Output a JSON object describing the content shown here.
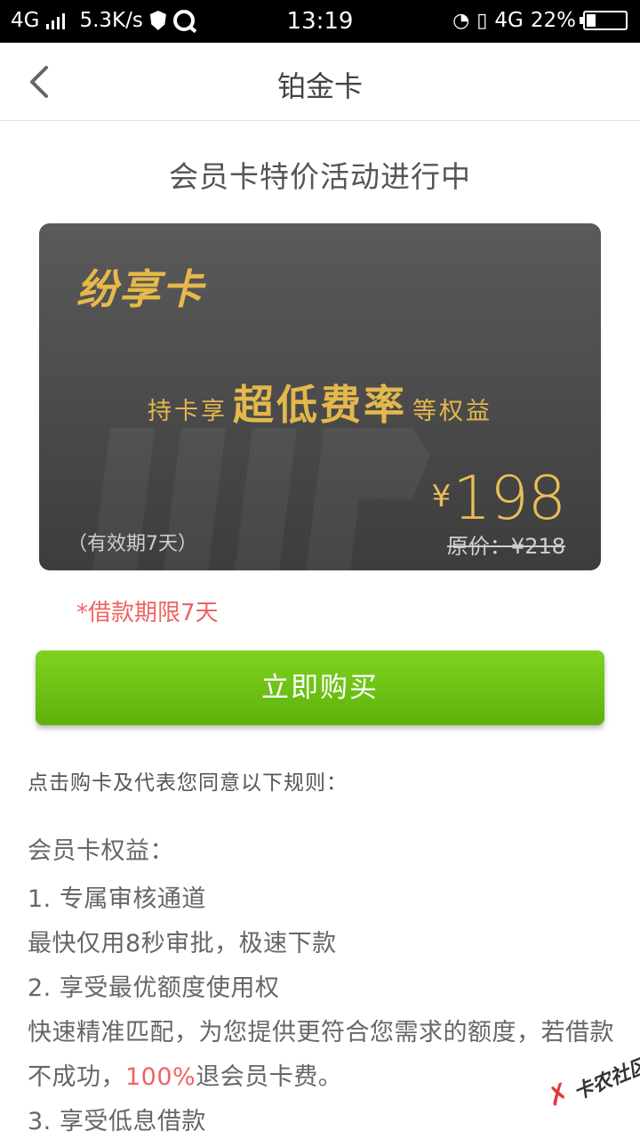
{
  "status_bar": {
    "network": "4G",
    "speed": "5.3K/s",
    "time": "13:19",
    "network2": "4G",
    "battery": "22%",
    "battery_level": 0.22
  },
  "nav": {
    "title": "铂金卡"
  },
  "promo": {
    "text": "会员卡特价活动进行中"
  },
  "card": {
    "brand": "纷享卡",
    "benefit_prefix": "持卡享",
    "benefit_main": "超低费率",
    "benefit_suffix": "等权益",
    "validity": "（有效期7天）",
    "currency": "¥",
    "price": "198",
    "original_price": "原价：¥218"
  },
  "limit_note": "*借款期限7天",
  "buy_button": {
    "label": "立即购买"
  },
  "agree_text": "点击购卡及代表您同意以下规则：",
  "rules": {
    "heading": "会员卡权益：",
    "item1_title": "1. 专属审核通道",
    "item1_desc": "最快仅用8秒审批，极速下款",
    "item2_title": "2. 享受最优额度使用权",
    "item2_desc_a": "快速精准匹配，为您提供更符合您需求的额度，若借款不成功，",
    "item2_highlight": "100%",
    "item2_desc_b": "退会员卡费。",
    "item3_title": "3. 享受低息借款"
  },
  "watermark": {
    "text": "卡农社区"
  },
  "colors": {
    "accent_green": "#6cc416",
    "gold": "#e3b84c",
    "highlight_red": "#ef6363"
  }
}
